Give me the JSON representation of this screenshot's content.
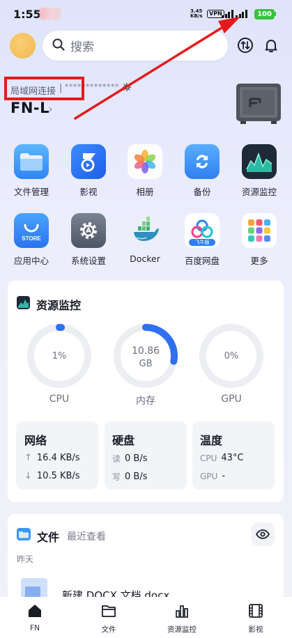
{
  "status_bar": {
    "time": "1:55",
    "speed_value": "3.45",
    "speed_unit": "KB/s",
    "vpn": "VPN",
    "battery": "100"
  },
  "header": {
    "search_placeholder": "搜索"
  },
  "connection": {
    "mode_label": "局域网连接",
    "separator": "|",
    "address_masked": "*************",
    "device_name": "FN-L"
  },
  "apps": [
    {
      "label": "文件管理",
      "icon": "folder-icon"
    },
    {
      "label": "影视",
      "icon": "video-play-icon"
    },
    {
      "label": "相册",
      "icon": "photos-flower-icon"
    },
    {
      "label": "备份",
      "icon": "backup-sync-icon"
    },
    {
      "label": "资源监控",
      "icon": "resource-monitor-icon"
    },
    {
      "label": "应用中心",
      "icon": "app-store-icon"
    },
    {
      "label": "系统设置",
      "icon": "settings-gear-icon"
    },
    {
      "label": "Docker",
      "icon": "docker-whale-icon"
    },
    {
      "label": "百度网盘",
      "icon": "baidu-netdisk-icon",
      "badge": "飞牛版"
    },
    {
      "label": "更多",
      "icon": "more-apps-icon"
    }
  ],
  "monitor": {
    "title": "资源监控",
    "gauges": [
      {
        "label": "CPU",
        "value": "1%",
        "unit": "",
        "fraction": 0.01
      },
      {
        "label": "内存",
        "value": "10.86",
        "unit": "GB",
        "fraction": 0.28
      },
      {
        "label": "GPU",
        "value": "0%",
        "unit": "",
        "fraction": 0
      }
    ],
    "network": {
      "title": "网络",
      "up": "16.4 KB/s",
      "down": "10.5 KB/s"
    },
    "disk": {
      "title": "硬盘",
      "read_label": "读",
      "read": "0 B/s",
      "write_label": "写",
      "write": "0 B/s"
    },
    "temperature": {
      "title": "温度",
      "cpu_label": "CPU",
      "cpu": "43°C",
      "gpu_label": "GPU",
      "gpu": "-"
    }
  },
  "files": {
    "title": "文件",
    "subtitle": "最近查看",
    "group": "昨天",
    "recent": [
      {
        "name": "新建 DOCX 文档.docx",
        "icon": "docx-file-icon"
      }
    ]
  },
  "bottom_nav": [
    {
      "label": "FN",
      "icon": "home-icon",
      "active": true
    },
    {
      "label": "文件",
      "icon": "folder-outline-icon",
      "active": false
    },
    {
      "label": "资源监控",
      "icon": "bar-chart-icon",
      "active": false
    },
    {
      "label": "影视",
      "icon": "film-icon",
      "active": false
    }
  ],
  "colors": {
    "accent_blue": "#2f6ff0",
    "annotation_red": "#e5191c",
    "battery_green": "#39c140"
  }
}
